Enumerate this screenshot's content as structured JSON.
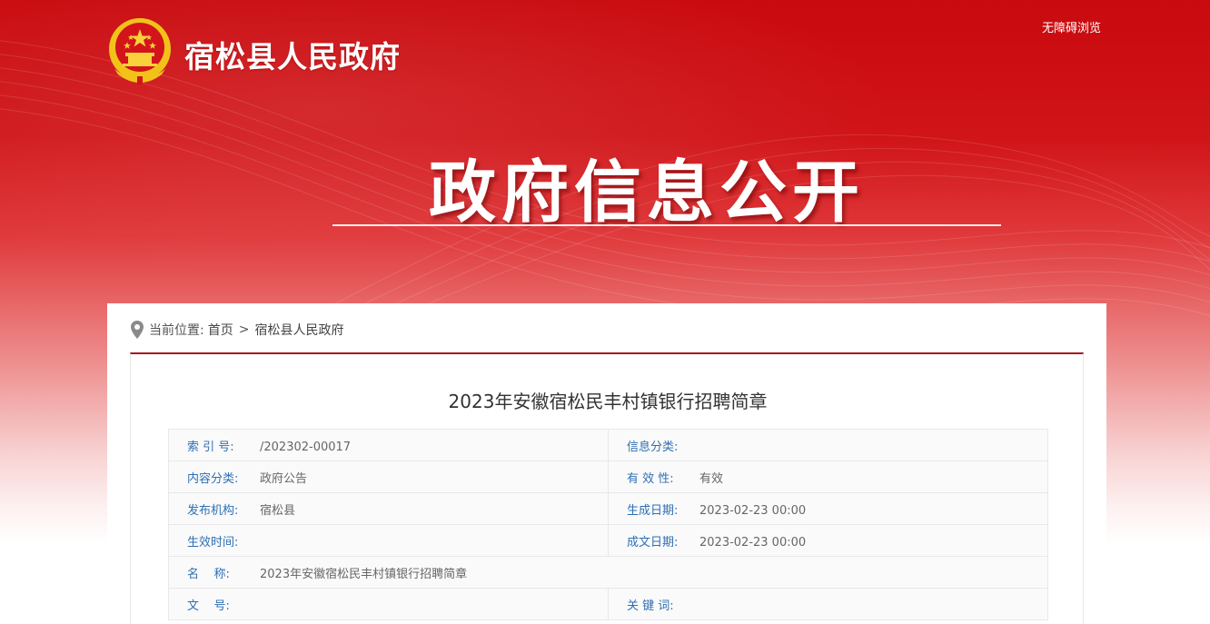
{
  "header": {
    "site_name": "宿松县人民政府",
    "accessibility_link": "无障碍浏览",
    "hero_title": "政府信息公开"
  },
  "breadcrumb": {
    "prefix": "当前位置:",
    "home": "首页",
    "separator": ">",
    "current": "宿松县人民政府"
  },
  "article": {
    "title": "2023年安徽宿松民丰村镇银行招聘简章"
  },
  "metadata": {
    "rows": [
      [
        {
          "label": "索 引 号:",
          "value": "/202302-00017"
        },
        {
          "label": "信息分类:",
          "value": ""
        }
      ],
      [
        {
          "label": "内容分类:",
          "value": "政府公告"
        },
        {
          "label": "有 效 性:",
          "value": "有效"
        }
      ],
      [
        {
          "label": "发布机构:",
          "value": "宿松县"
        },
        {
          "label": "生成日期:",
          "value": "2023-02-23 00:00"
        }
      ],
      [
        {
          "label": "生效时间:",
          "value": ""
        },
        {
          "label": "成文日期:",
          "value": "2023-02-23 00:00"
        }
      ],
      [
        {
          "label": "名    称:",
          "value": "2023年安徽宿松民丰村镇银行招聘简章"
        }
      ],
      [
        {
          "label": "文    号:",
          "value": ""
        },
        {
          "label": "关 键 词:",
          "value": ""
        }
      ]
    ]
  },
  "colors": {
    "brand_red": "#c90a0e",
    "accent_line": "#a4161b",
    "label_blue": "#2f6fb3"
  },
  "icons": {
    "emblem": "national-emblem-icon",
    "location": "location-pin-icon"
  }
}
